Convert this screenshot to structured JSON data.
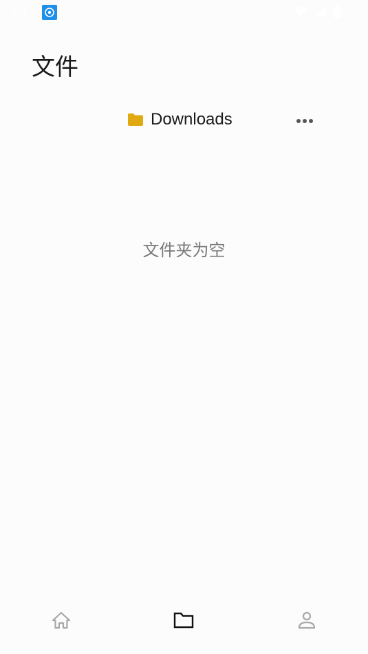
{
  "status_bar": {
    "time": "3:3",
    "app_icon": "app-notification-icon",
    "icons": [
      "wifi-icon",
      "cell-signal-icon",
      "battery-icon"
    ]
  },
  "header": {
    "title": "文件"
  },
  "breadcrumb": {
    "folder_name": "Downloads",
    "folder_icon": "folder-icon",
    "folder_color": "#e1a911",
    "more_icon": "more-horizontal-icon"
  },
  "main": {
    "empty_message": "文件夹为空"
  },
  "bottom_nav": {
    "items": [
      {
        "name": "home",
        "icon": "home-icon",
        "active": false
      },
      {
        "name": "files",
        "icon": "folder-outline-icon",
        "active": true
      },
      {
        "name": "profile",
        "icon": "person-icon",
        "active": false
      }
    ],
    "active_color": "#111111",
    "inactive_color": "#a8a8a8"
  }
}
